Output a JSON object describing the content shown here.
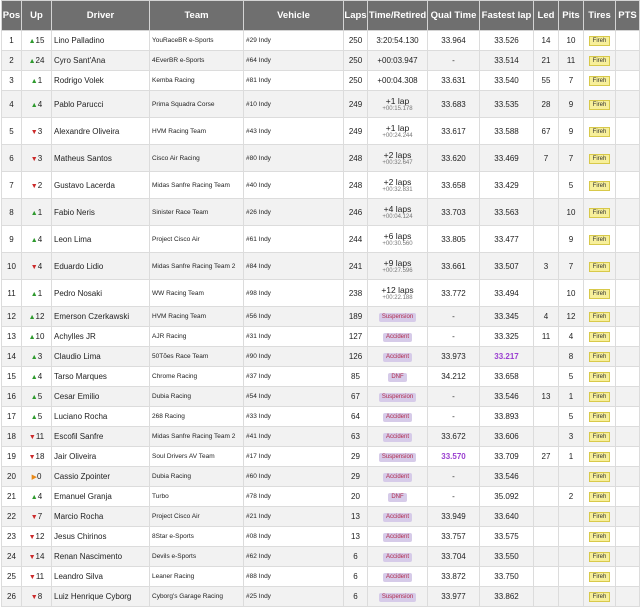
{
  "headers": [
    "Pos",
    "Up",
    "Driver",
    "Team",
    "Vehicle",
    "Laps",
    "Time/Retired",
    "Qual Time",
    "Fastest lap",
    "Led",
    "Pits",
    "Tires",
    "PTS"
  ],
  "rows": [
    {
      "pos": "1",
      "dir": "up",
      "up": "15",
      "driver": "Lino Palladino",
      "team": "YouRaceBR e-Sports",
      "vehicle": "#29 Indy",
      "laps": "250",
      "time": "3:20:54.130",
      "sub": "",
      "status": "",
      "qual": "33.964",
      "fast": "33.526",
      "led": "14",
      "pits": "10",
      "tires": "Fireh",
      "pts": "",
      "tall": false
    },
    {
      "pos": "2",
      "dir": "up",
      "up": "24",
      "driver": "Cyro Sant'Ana",
      "team": "4EverBR e-Sports",
      "vehicle": "#64 Indy",
      "laps": "250",
      "time": "+00:03.947",
      "sub": "",
      "status": "",
      "qual": "-",
      "fast": "33.514",
      "led": "21",
      "pits": "11",
      "tires": "Fireh",
      "pts": "",
      "tall": false
    },
    {
      "pos": "3",
      "dir": "up",
      "up": "1",
      "driver": "Rodrigo Volek",
      "team": "Kemba Racing",
      "vehicle": "#81 Indy",
      "laps": "250",
      "time": "+00:04.308",
      "sub": "",
      "status": "",
      "qual": "33.631",
      "fast": "33.540",
      "led": "55",
      "pits": "7",
      "tires": "Fireh",
      "pts": "",
      "tall": false
    },
    {
      "pos": "4",
      "dir": "up",
      "up": "4",
      "driver": "Pablo Parucci",
      "team": "Prima Squadra Corse",
      "vehicle": "#10 Indy",
      "laps": "249",
      "time": "+1 lap",
      "sub": "+00:15.178",
      "status": "",
      "qual": "33.683",
      "fast": "33.535",
      "led": "28",
      "pits": "9",
      "tires": "Fireh",
      "pts": "",
      "tall": true
    },
    {
      "pos": "5",
      "dir": "down",
      "up": "3",
      "driver": "Alexandre Oliveira",
      "team": "HVM Racing Team",
      "vehicle": "#43 Indy",
      "laps": "249",
      "time": "+1 lap",
      "sub": "+00:24.244",
      "status": "",
      "qual": "33.617",
      "fast": "33.588",
      "led": "67",
      "pits": "9",
      "tires": "Fireh",
      "pts": "",
      "tall": true
    },
    {
      "pos": "6",
      "dir": "down",
      "up": "3",
      "driver": "Matheus Santos",
      "team": "Cisco Air Racing",
      "vehicle": "#80 Indy",
      "laps": "248",
      "time": "+2 laps",
      "sub": "+00:32.647",
      "status": "",
      "qual": "33.620",
      "fast": "33.469",
      "led": "7",
      "pits": "7",
      "tires": "Fireh",
      "pts": "",
      "tall": true
    },
    {
      "pos": "7",
      "dir": "down",
      "up": "2",
      "driver": "Gustavo Lacerda",
      "team": "Midas Sanfre Racing Team",
      "vehicle": "#40 Indy",
      "laps": "248",
      "time": "+2 laps",
      "sub": "+00:32.831",
      "status": "",
      "qual": "33.658",
      "fast": "33.429",
      "led": "",
      "pits": "5",
      "tires": "Fireh",
      "pts": "",
      "tall": true
    },
    {
      "pos": "8",
      "dir": "up",
      "up": "1",
      "driver": "Fabio Neris",
      "team": "Sinister Race Team",
      "vehicle": "#26 Indy",
      "laps": "246",
      "time": "+4 laps",
      "sub": "+00:04.124",
      "status": "",
      "qual": "33.703",
      "fast": "33.563",
      "led": "",
      "pits": "10",
      "tires": "Fireh",
      "pts": "",
      "tall": true
    },
    {
      "pos": "9",
      "dir": "up",
      "up": "4",
      "driver": "Leon Lima",
      "team": "Project Cisco Air",
      "vehicle": "#61 Indy",
      "laps": "244",
      "time": "+6 laps",
      "sub": "+00:30.560",
      "status": "",
      "qual": "33.805",
      "fast": "33.477",
      "led": "",
      "pits": "9",
      "tires": "Fireh",
      "pts": "",
      "tall": true
    },
    {
      "pos": "10",
      "dir": "down",
      "up": "4",
      "driver": "Eduardo Lidio",
      "team": "Midas Sanfre Racing Team 2",
      "vehicle": "#84 Indy",
      "laps": "241",
      "time": "+9 laps",
      "sub": "+00:27.596",
      "status": "",
      "qual": "33.661",
      "fast": "33.507",
      "led": "3",
      "pits": "7",
      "tires": "Fireh",
      "pts": "",
      "tall": true
    },
    {
      "pos": "11",
      "dir": "up",
      "up": "1",
      "driver": "Pedro Nosaki",
      "team": "WW Racing Team",
      "vehicle": "#98 Indy",
      "laps": "238",
      "time": "+12 laps",
      "sub": "+00:22.188",
      "status": "",
      "qual": "33.772",
      "fast": "33.494",
      "led": "",
      "pits": "10",
      "tires": "Fireh",
      "pts": "",
      "tall": true
    },
    {
      "pos": "12",
      "dir": "up",
      "up": "12",
      "driver": "Emerson Czerkawski",
      "team": "HVM Racing Team",
      "vehicle": "#56 Indy",
      "laps": "189",
      "time": "",
      "sub": "",
      "status": "Suspension",
      "qual": "-",
      "fast": "33.345",
      "led": "4",
      "pits": "12",
      "tires": "Fireh",
      "pts": "",
      "tall": false
    },
    {
      "pos": "13",
      "dir": "up",
      "up": "10",
      "driver": "Achylles JR",
      "team": "AJR Racing",
      "vehicle": "#31 Indy",
      "laps": "127",
      "time": "",
      "sub": "",
      "status": "Accident",
      "qual": "-",
      "fast": "33.325",
      "led": "11",
      "pits": "4",
      "tires": "Fireh",
      "pts": "",
      "tall": false
    },
    {
      "pos": "14",
      "dir": "up",
      "up": "3",
      "driver": "Claudio Lima",
      "team": "50Tões Race Team",
      "vehicle": "#90 Indy",
      "laps": "126",
      "time": "",
      "sub": "",
      "status": "Accident",
      "qual": "33.973",
      "fast": "33.217",
      "led": "",
      "pits": "8",
      "tires": "Fireh",
      "pts": "",
      "tall": false,
      "fastBest": true
    },
    {
      "pos": "15",
      "dir": "up",
      "up": "4",
      "driver": "Tarso Marques",
      "team": "Chrome Racing",
      "vehicle": "#37 Indy",
      "laps": "85",
      "time": "",
      "sub": "",
      "status": "DNF",
      "qual": "34.212",
      "fast": "33.658",
      "led": "",
      "pits": "5",
      "tires": "Fireh",
      "pts": "",
      "tall": false
    },
    {
      "pos": "16",
      "dir": "up",
      "up": "5",
      "driver": "Cesar Emilio",
      "team": "Dubia Racing",
      "vehicle": "#54 Indy",
      "laps": "67",
      "time": "",
      "sub": "",
      "status": "Suspension",
      "qual": "-",
      "fast": "33.546",
      "led": "13",
      "pits": "1",
      "tires": "Fireh",
      "pts": "",
      "tall": false
    },
    {
      "pos": "17",
      "dir": "up",
      "up": "5",
      "driver": "Luciano Rocha",
      "team": "268 Racing",
      "vehicle": "#33 Indy",
      "laps": "64",
      "time": "",
      "sub": "",
      "status": "Accident",
      "qual": "-",
      "fast": "33.893",
      "led": "",
      "pits": "5",
      "tires": "Fireh",
      "pts": "",
      "tall": false
    },
    {
      "pos": "18",
      "dir": "down",
      "up": "11",
      "driver": "Escofil Sanfre",
      "team": "Midas Sanfre Racing Team 2",
      "vehicle": "#41 Indy",
      "laps": "63",
      "time": "",
      "sub": "",
      "status": "Accident",
      "qual": "33.672",
      "fast": "33.606",
      "led": "",
      "pits": "3",
      "tires": "Fireh",
      "pts": "",
      "tall": false
    },
    {
      "pos": "19",
      "dir": "down",
      "up": "18",
      "driver": "Jair Oliveira",
      "team": "Soul Drivers AV Team",
      "vehicle": "#17 Indy",
      "laps": "29",
      "time": "",
      "sub": "",
      "status": "Suspension",
      "qual": "33.570",
      "fast": "33.709",
      "led": "27",
      "pits": "1",
      "tires": "Fireh",
      "pts": "",
      "tall": false,
      "qualBest": true
    },
    {
      "pos": "20",
      "dir": "eq",
      "up": "0",
      "driver": "Cassio Zpointer",
      "team": "Dubia Racing",
      "vehicle": "#60 Indy",
      "laps": "29",
      "time": "",
      "sub": "",
      "status": "Accident",
      "qual": "-",
      "fast": "33.546",
      "led": "",
      "pits": "",
      "tires": "Fireh",
      "pts": "",
      "tall": false
    },
    {
      "pos": "21",
      "dir": "up",
      "up": "4",
      "driver": "Emanuel Granja",
      "team": "Turbo",
      "vehicle": "#78 Indy",
      "laps": "20",
      "time": "",
      "sub": "",
      "status": "DNF",
      "qual": "-",
      "fast": "35.092",
      "led": "",
      "pits": "2",
      "tires": "Fireh",
      "pts": "",
      "tall": false
    },
    {
      "pos": "22",
      "dir": "down",
      "up": "7",
      "driver": "Marcio Rocha",
      "team": "Project Cisco Air",
      "vehicle": "#21 Indy",
      "laps": "13",
      "time": "",
      "sub": "",
      "status": "Accident",
      "qual": "33.949",
      "fast": "33.640",
      "led": "",
      "pits": "",
      "tires": "Fireh",
      "pts": "",
      "tall": false
    },
    {
      "pos": "23",
      "dir": "down",
      "up": "12",
      "driver": "Jesus Chirinos",
      "team": "8Star e-Sports",
      "vehicle": "#08 Indy",
      "laps": "13",
      "time": "",
      "sub": "",
      "status": "Accident",
      "qual": "33.757",
      "fast": "33.575",
      "led": "",
      "pits": "",
      "tires": "Fireh",
      "pts": "",
      "tall": false
    },
    {
      "pos": "24",
      "dir": "down",
      "up": "14",
      "driver": "Renan Nascimento",
      "team": "Devils e-Sports",
      "vehicle": "#62 Indy",
      "laps": "6",
      "time": "",
      "sub": "",
      "status": "Accident",
      "qual": "33.704",
      "fast": "33.550",
      "led": "",
      "pits": "",
      "tires": "Fireh",
      "pts": "",
      "tall": false
    },
    {
      "pos": "25",
      "dir": "down",
      "up": "11",
      "driver": "Leandro Silva",
      "team": "Leaner Racing",
      "vehicle": "#88 Indy",
      "laps": "6",
      "time": "",
      "sub": "",
      "status": "Accident",
      "qual": "33.872",
      "fast": "33.750",
      "led": "",
      "pits": "",
      "tires": "Fireh",
      "pts": "",
      "tall": false
    },
    {
      "pos": "26",
      "dir": "down",
      "up": "8",
      "driver": "Luiz Henrique Cyborg",
      "team": "Cyborg's Garage Racing",
      "vehicle": "#25 Indy",
      "laps": "6",
      "time": "",
      "sub": "",
      "status": "Suspension",
      "qual": "33.977",
      "fast": "33.862",
      "led": "",
      "pits": "",
      "tires": "Fireh",
      "pts": "",
      "tall": false
    }
  ]
}
